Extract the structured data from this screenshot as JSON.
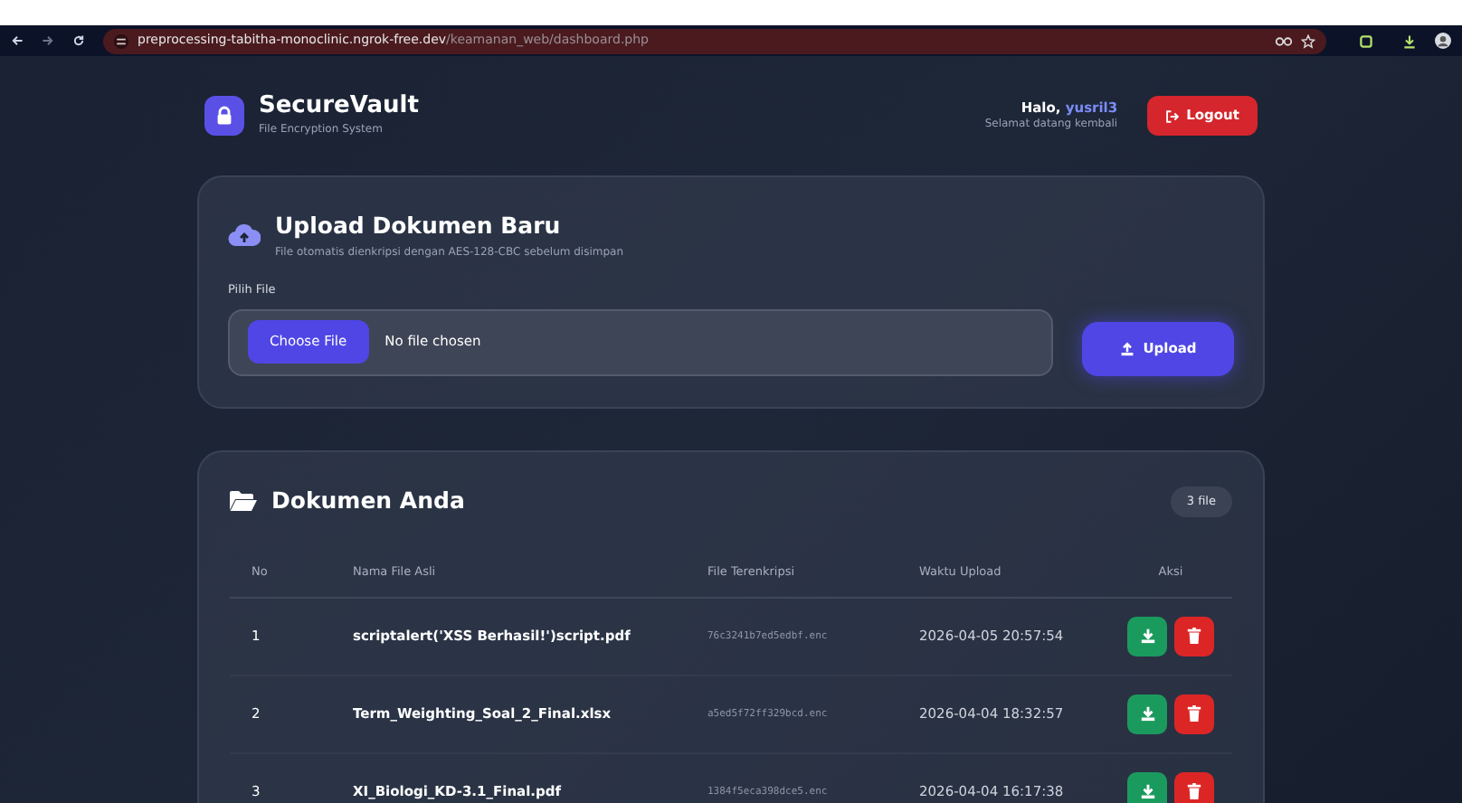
{
  "browser": {
    "url_domain": "preprocessing-tabitha-monoclinic.ngrok-free.dev",
    "url_path": "/keamanan_web/dashboard.php"
  },
  "header": {
    "brand": "SecureVault",
    "subtitle": "File Encryption System",
    "greeting": "Halo, ",
    "username": "yusril3",
    "welcome": "Selamat datang kembali",
    "logout": "Logout"
  },
  "upload": {
    "title": "Upload Dokumen Baru",
    "subtitle": "File otomatis dienkripsi dengan AES-128-CBC sebelum disimpan",
    "field_label": "Pilih File",
    "choose_button": "Choose File",
    "file_status": "No file chosen",
    "upload_button": "Upload"
  },
  "documents": {
    "title": "Dokumen Anda",
    "count": "3 file",
    "columns": [
      "No",
      "Nama File Asli",
      "File Terenkripsi",
      "Waktu Upload",
      "Aksi"
    ],
    "rows": [
      {
        "no": "1",
        "name": "scriptalert('XSS Berhasil!')script.pdf",
        "encrypted": "76c3241b7ed5edbf.enc",
        "time": "2026-04-05 20:57:54"
      },
      {
        "no": "2",
        "name": "Term_Weighting_Soal_2_Final.xlsx",
        "encrypted": "a5ed5f72ff329bcd.enc",
        "time": "2026-04-04 18:32:57"
      },
      {
        "no": "3",
        "name": "XI_Biologi_KD-3.1_Final.pdf",
        "encrypted": "1384f5eca398dce5.enc",
        "time": "2026-04-04 16:17:38"
      }
    ]
  }
}
